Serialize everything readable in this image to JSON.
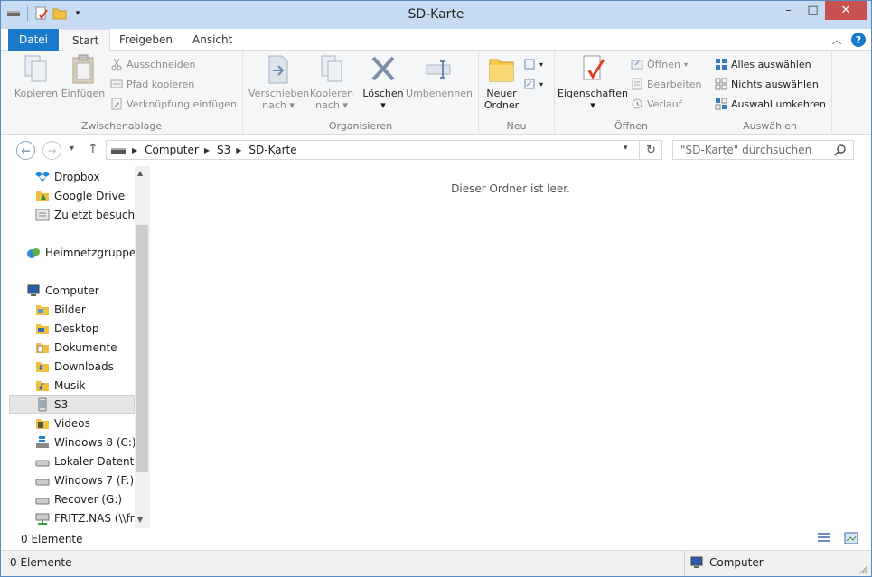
{
  "window": {
    "title": "SD-Karte"
  },
  "ribbon_tabs": [
    "Datei",
    "Start",
    "Freigeben",
    "Ansicht"
  ],
  "ribbon": {
    "zwischenablage": {
      "label": "Zwischenablage",
      "kopieren": "Kopieren",
      "einfuegen": "Einfügen",
      "ausschneiden": "Ausschneiden",
      "pfad_kopieren": "Pfad kopieren",
      "verknuepfung": "Verknüpfung einfügen"
    },
    "organisieren": {
      "label": "Organisieren",
      "verschieben": "Verschieben",
      "verschieben_sub": "nach",
      "kopieren": "Kopieren",
      "kopieren_sub": "nach",
      "loeschen": "Löschen",
      "umbenennen": "Umbenennen"
    },
    "neu": {
      "label": "Neu",
      "neuer": "Neuer",
      "ordner": "Ordner"
    },
    "oeffnen": {
      "label": "Öffnen",
      "eigenschaften": "Eigenschaften",
      "oeffnen": "Öffnen",
      "bearbeiten": "Bearbeiten",
      "verlauf": "Verlauf"
    },
    "auswaehlen": {
      "label": "Auswählen",
      "alle": "Alles auswählen",
      "nichts": "Nichts auswählen",
      "umkehren": "Auswahl umkehren"
    }
  },
  "address": {
    "crumbs": [
      "Computer",
      "S3",
      "SD-Karte"
    ],
    "search_placeholder": "\"SD-Karte\" durchsuchen"
  },
  "nav": {
    "items": [
      "Dropbox",
      "Google Drive",
      "Zuletzt besucht",
      "Heimnetzgruppe",
      "Computer",
      "Bilder",
      "Desktop",
      "Dokumente",
      "Downloads",
      "Musik",
      "S3",
      "Videos",
      "Windows 8 (C:)",
      "Lokaler Datenträg",
      "Windows 7 (F:)",
      "Recover (G:)",
      "FRITZ.NAS (\\\\frit"
    ]
  },
  "content": {
    "empty_message": "Dieser Ordner ist leer."
  },
  "status": {
    "count": "0 Elemente",
    "count_bottom": "0 Elemente",
    "location": "Computer"
  },
  "colors": {
    "accent": "#1979ca",
    "titlebar": "#c7dcf2",
    "close": "#c75050"
  }
}
